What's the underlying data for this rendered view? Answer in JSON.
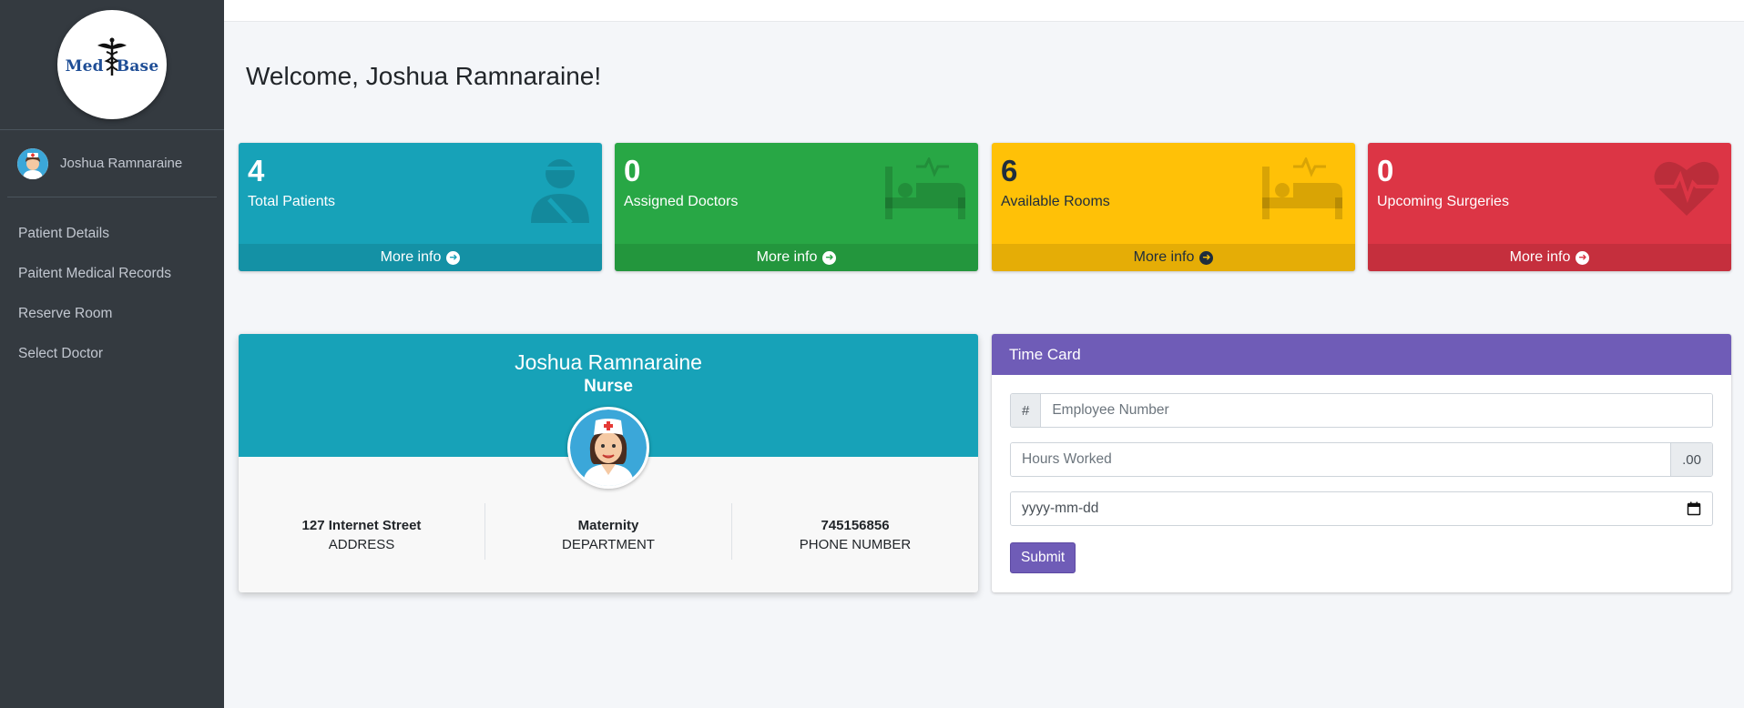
{
  "brand": {
    "word1": "Med",
    "word2": "Base"
  },
  "user": {
    "name": "Joshua Ramnaraine"
  },
  "sidebar": {
    "items": [
      {
        "label": "Patient Details"
      },
      {
        "label": "Paitent Medical Records"
      },
      {
        "label": "Reserve Room"
      },
      {
        "label": "Select Doctor"
      }
    ]
  },
  "welcome": "Welcome, Joshua Ramnaraine!",
  "stats": [
    {
      "value": "4",
      "label": "Total Patients",
      "footer": "More info",
      "icon": "injured-person-icon",
      "color": "#17a2b8"
    },
    {
      "value": "0",
      "label": "Assigned Doctors",
      "footer": "More info",
      "icon": "hospital-bed-icon",
      "color": "#28a745"
    },
    {
      "value": "6",
      "label": "Available Rooms",
      "footer": "More info",
      "icon": "hospital-bed-icon",
      "color": "#ffc107"
    },
    {
      "value": "0",
      "label": "Upcoming Surgeries",
      "footer": "More info",
      "icon": "heartbeat-icon",
      "color": "#dc3545"
    }
  ],
  "profile": {
    "name": "Joshua Ramnaraine",
    "role": "Nurse",
    "address": {
      "value": "127 Internet Street",
      "label": "ADDRESS"
    },
    "department": {
      "value": "Maternity",
      "label": "DEPARTMENT"
    },
    "phone": {
      "value": "745156856",
      "label": "PHONE NUMBER"
    }
  },
  "timecard": {
    "title": "Time Card",
    "hash_addon": "#",
    "employee_placeholder": "Employee Number",
    "hours_placeholder": "Hours Worked",
    "hours_addon": ".00",
    "date_placeholder": "yyyy-mm-dd",
    "submit_label": "Submit"
  },
  "colors": {
    "sidebar": "#343a40",
    "accent_purple": "#6f5cb7",
    "info": "#17a2b8",
    "success": "#28a745",
    "warning": "#ffc107",
    "danger": "#dc3545"
  }
}
